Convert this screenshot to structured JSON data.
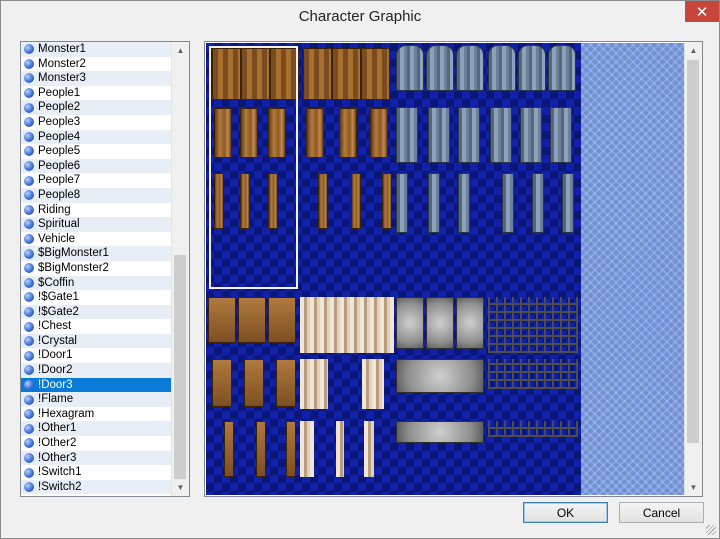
{
  "window": {
    "title": "Character Graphic",
    "close_glyph": "✕"
  },
  "list": {
    "selected_index": 23,
    "items": [
      "Monster1",
      "Monster2",
      "Monster3",
      "People1",
      "People2",
      "People3",
      "People4",
      "People5",
      "People6",
      "People7",
      "People8",
      "Riding",
      "Spiritual",
      "Vehicle",
      "$BigMonster1",
      "$BigMonster2",
      "$Coffin",
      "!$Gate1",
      "!$Gate2",
      "!Chest",
      "!Crystal",
      "!Door1",
      "!Door2",
      "!Door3",
      "!Flame",
      "!Hexagram",
      "!Other1",
      "!Other2",
      "!Other3",
      "!Switch1",
      "!Switch2"
    ]
  },
  "buttons": {
    "ok": "OK",
    "cancel": "Cancel"
  },
  "colors": {
    "selection": "#0a7ad6",
    "close": "#c7463c",
    "sheet_bg": "#1020a8"
  },
  "icons": {
    "item_bullet": "blue-orb-icon",
    "scroll_up": "chevron-up-icon",
    "scroll_down": "chevron-down-icon"
  }
}
